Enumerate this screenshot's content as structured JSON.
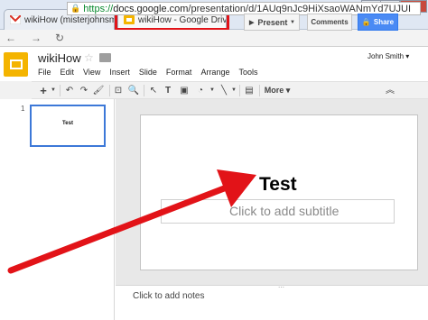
{
  "browser": {
    "tabs": [
      {
        "title": "wikiHow (misterjohnsmith",
        "close": "×"
      },
      {
        "title": "wikiHow - Google Drive",
        "close": "×"
      }
    ],
    "window_controls": {
      "minimize": "—",
      "maximize": "▭",
      "close": "✕"
    },
    "url": {
      "secure_part": "https://",
      "host": "docs.google.com",
      "path": "/presentation/d/1AUq9nJc9HiXsaoWANmYd7UJUI"
    }
  },
  "app": {
    "doc_title": "wikiHow",
    "menu": [
      "File",
      "Edit",
      "View",
      "Insert",
      "Slide",
      "Format",
      "Arrange",
      "Tools"
    ],
    "user": "John Smith",
    "present_label": "Present",
    "comments_label": "Comments",
    "share_label": "Share",
    "toolbar": {
      "more_label": "More"
    }
  },
  "filmstrip": {
    "slides": [
      {
        "number": "1",
        "title": "Test"
      }
    ]
  },
  "slide": {
    "title": "Test",
    "subtitle_placeholder": "Click to add subtitle"
  },
  "notes": {
    "placeholder": "Click to add notes"
  },
  "colors": {
    "highlight": "#e21318",
    "share": "#4a8af4",
    "slides_logo": "#f4b400",
    "selection": "#3c78d8"
  }
}
